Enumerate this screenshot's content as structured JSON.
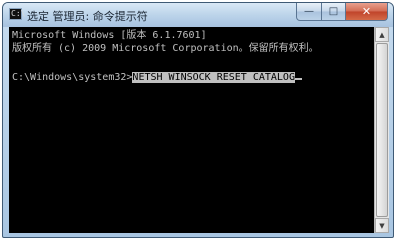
{
  "window": {
    "title": "选定 管理员: 命令提示符",
    "icon": "cmd-icon",
    "icon_glyph": "C:\\",
    "controls": {
      "minimize_glyph": "—",
      "maximize_glyph": "□",
      "close_glyph": "✕"
    }
  },
  "console": {
    "lines": [
      "Microsoft Windows [版本 6.1.7601]",
      "版权所有 (c) 2009 Microsoft Corporation。保留所有权利。",
      "",
      "C:\\Windows\\system32>"
    ],
    "command": "NETSH WINSOCK RESET CATALOG"
  },
  "scrollbar": {
    "up_glyph": "▲",
    "down_glyph": "▼"
  },
  "colors": {
    "console_bg": "#000000",
    "console_fg": "#c0c0c0",
    "selection_bg": "#c0c0c0",
    "close_button": "#c0432a"
  }
}
